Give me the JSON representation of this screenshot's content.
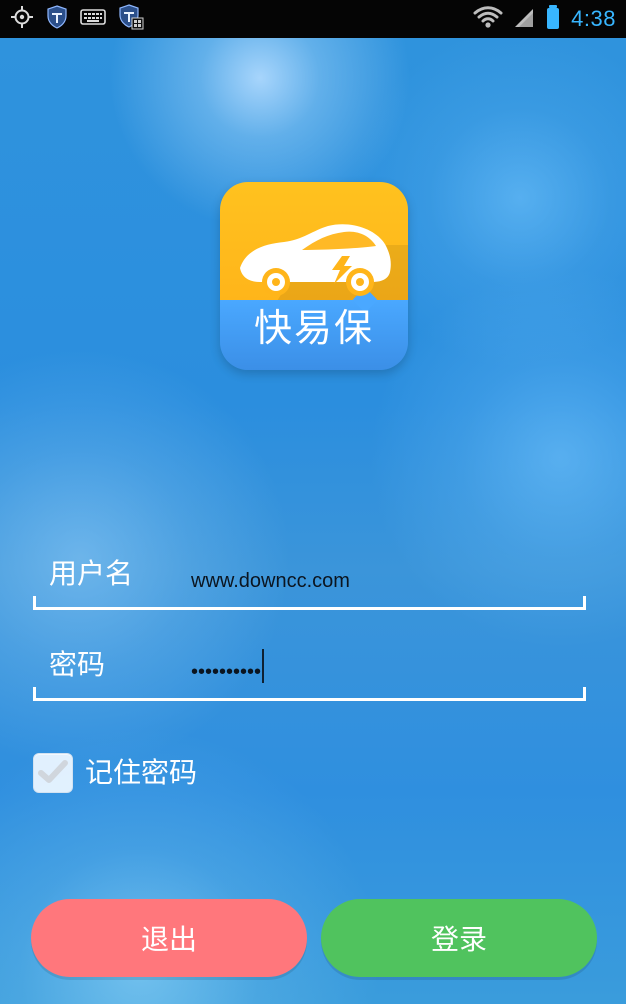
{
  "status_bar": {
    "time": "4:38",
    "icons_left": [
      "gps-icon",
      "shield-icon",
      "keyboard-icon",
      "shield-grid-icon"
    ],
    "icons_right": [
      "wifi-icon",
      "signal-icon",
      "battery-icon"
    ],
    "accent_color": "#38b6ff"
  },
  "logo": {
    "text": "快易保",
    "top_color": "#ffb51a",
    "bottom_color": "#3b8fe7"
  },
  "form": {
    "username_label": "用户名",
    "username_value": "www.downcc.com",
    "password_label": "密码",
    "password_value": "••••••••••"
  },
  "remember": {
    "label": "记住密码",
    "checked": true
  },
  "buttons": {
    "exit_label": "退出",
    "login_label": "登录",
    "exit_color": "#ff777c",
    "login_color": "#50c35e"
  }
}
